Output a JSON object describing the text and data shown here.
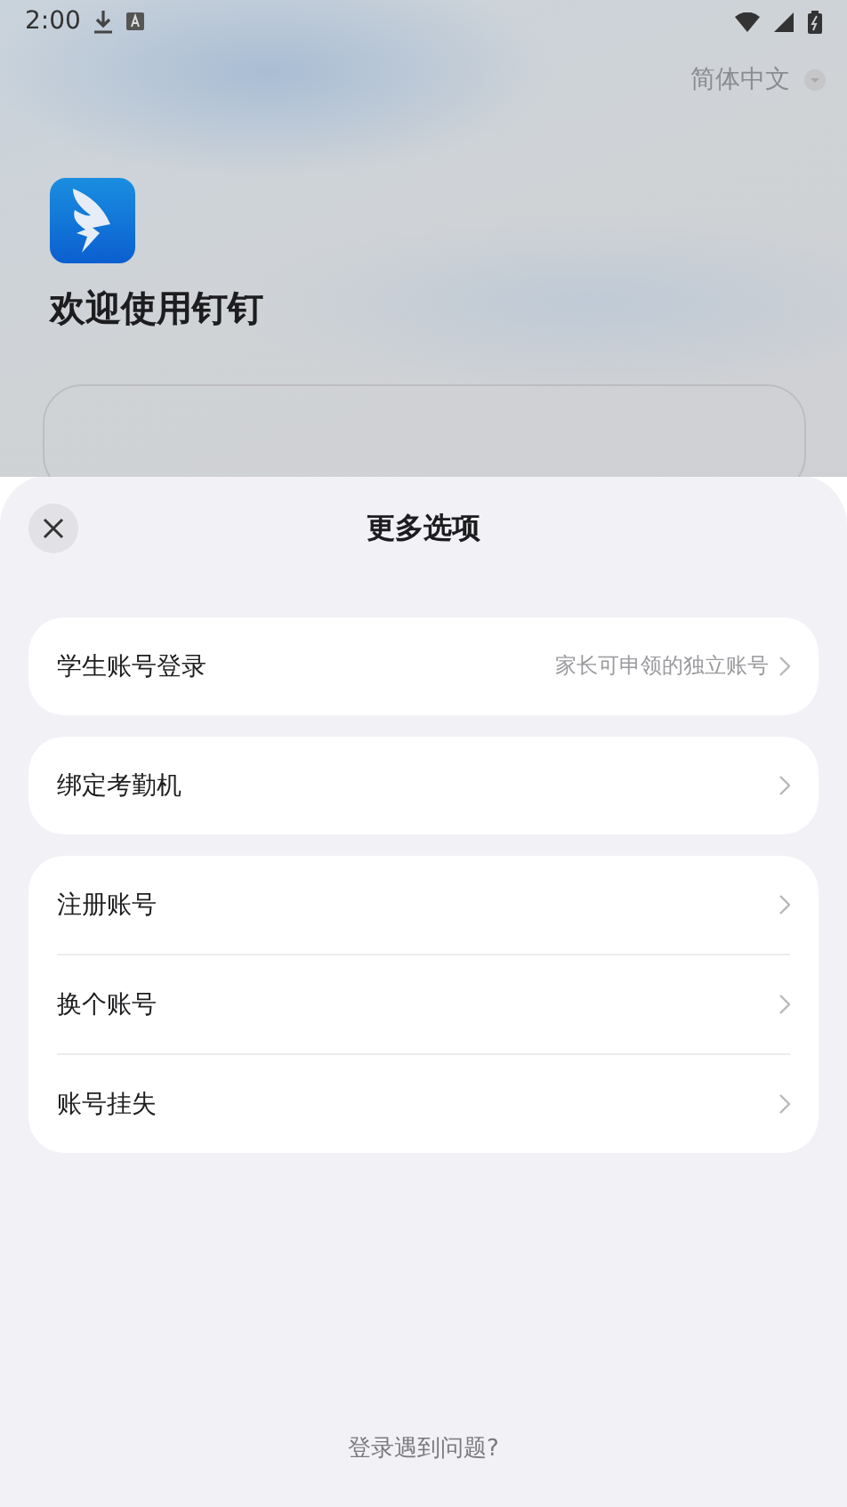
{
  "status_bar": {
    "time": "2:00"
  },
  "language": "简体中文",
  "welcome_title": "欢迎使用钉钉",
  "sheet": {
    "title": "更多选项",
    "groups": [
      {
        "items": [
          {
            "label": "学生账号登录",
            "hint": "家长可申领的独立账号"
          }
        ]
      },
      {
        "items": [
          {
            "label": "绑定考勤机"
          }
        ]
      },
      {
        "items": [
          {
            "label": "注册账号"
          },
          {
            "label": "换个账号"
          },
          {
            "label": "账号挂失"
          }
        ]
      }
    ],
    "footer_link": "登录遇到问题?"
  }
}
